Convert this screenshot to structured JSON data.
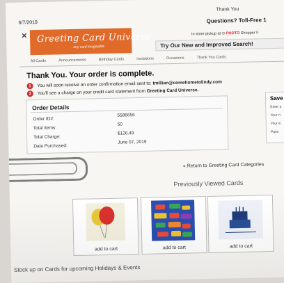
{
  "date": "6/7/2019",
  "top_title": "Thank You",
  "questions": "Questions? Toll-Free 1",
  "close_glyph": "×",
  "logo": {
    "brand": "Greeting Card Universe",
    "tagline": "any card imaginable",
    "color": "#e06a2a"
  },
  "pickup": {
    "prefix": "In-store pickup at",
    "photo": "PHOTO",
    "suffix": "Shopper F"
  },
  "banner": "Try Our New and Improved Search!",
  "nav": [
    "All Cards",
    "Announcements",
    "Birthday Cards",
    "Invitations",
    "Occasions",
    "Thank You Cards"
  ],
  "headline": "Thank You. Your order is complete.",
  "steps": [
    {
      "num": "1",
      "prefix": "You will soon receive an order confirmation email sent to:",
      "bold": "tmillian@comehometolindy.com"
    },
    {
      "num": "2",
      "prefix": "You'll see a charge on your credit card statement from",
      "bold": "Greeting Card Universe."
    }
  ],
  "order_details": {
    "title": "Order Details",
    "rows": [
      {
        "label": "Order ID#:",
        "value": "5586656"
      },
      {
        "label": "Total Items:",
        "value": "50"
      },
      {
        "label": "Total Charge:",
        "value": "$126.49"
      },
      {
        "label": "Date Purchased:",
        "value": "June 07, 2019"
      }
    ]
  },
  "save_box": {
    "title": "Save",
    "lines": [
      "Enter a",
      "Your n",
      "Your e",
      "Pass"
    ]
  },
  "return_link": "« Return to Greeting Card Categories",
  "previously_viewed": "Previously Viewed Cards",
  "cards": [
    {
      "caption": "add to cart",
      "icon": "balloon-card-icon"
    },
    {
      "caption": "add to cart",
      "icon": "colorful-birthday-card-icon"
    },
    {
      "caption": "add to cart",
      "icon": "happy-birthday-cake-card-icon"
    }
  ],
  "stock_text": "Stock up on Cards for upcoming Holidays & Events",
  "colors": {
    "accent_red": "#cc2c2c",
    "logo_orange": "#e06a2a",
    "photo_red": "#dd2222"
  }
}
